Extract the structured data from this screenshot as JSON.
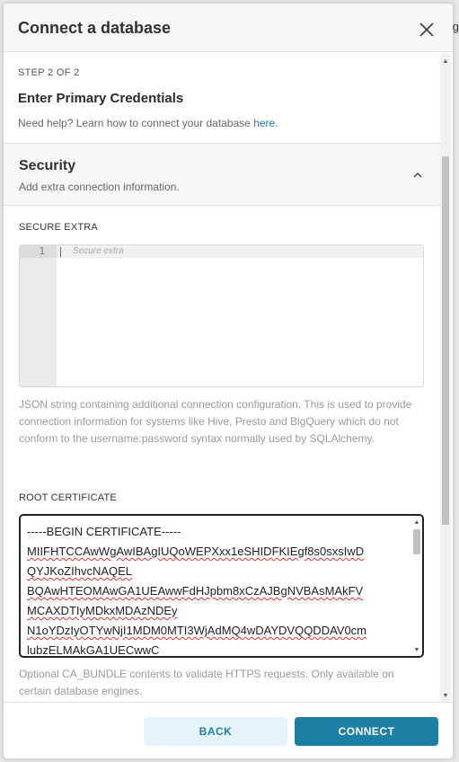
{
  "modal": {
    "title": "Connect a database"
  },
  "step": {
    "label": "STEP 2 OF 2",
    "title": "Enter Primary Credentials",
    "help_prefix": "Need help? Learn how to connect your database ",
    "help_link": "here",
    "help_suffix": "."
  },
  "security": {
    "title": "Security",
    "subtitle": "Add extra connection information.",
    "expanded": true
  },
  "secure_extra": {
    "label": "SECURE EXTRA",
    "line_number": "1",
    "placeholder": "Secure extra",
    "help": "JSON string containing additional connection configuration. This is used to provide connection information for systems like Hive, Presto and BigQuery which do not conform to the username:password syntax normally used by SQLAlchemy."
  },
  "root_certificate": {
    "label": "ROOT CERTIFICATE",
    "lines": [
      "-----BEGIN CERTIFICATE-----",
      "MIIFHTCCAwWgAwIBAgIUQoWEPXxx1eSHIDFKIEgf8s0sxsIwD",
      "QYJKoZIhvcNAQEL",
      "BQAwHTEOMAwGA1UEAwwFdHJpbm8xCzAJBgNVBAsMAkFV",
      "MCAXDTIyMDkxMDAzNDEy",
      "N1oYDzIyOTYwNjI1MDM0MTI3WjAdMQ4wDAYDVQQDDAV0cm",
      "lubzELMAkGA1UECwwC"
    ],
    "help": "Optional CA_BUNDLE contents to validate HTTPS requests. Only available on certain database engines."
  },
  "footer": {
    "back_label": "BACK",
    "connect_label": "CONNECT"
  },
  "colors": {
    "accent": "#1c7fa6",
    "back_bg": "#e4f4fa",
    "spell_error": "#dd3333"
  },
  "icons": {
    "close": "close-icon",
    "collapse": "chevron-up-icon"
  }
}
